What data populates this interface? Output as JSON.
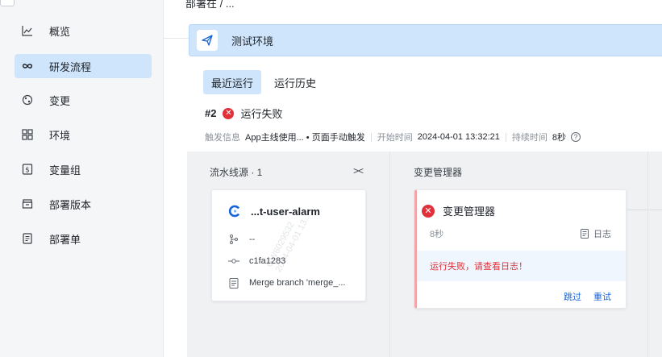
{
  "breadcrumb": "部署在 / ...",
  "sidebar": {
    "items": [
      {
        "label": "概览",
        "icon": "chart-line-icon"
      },
      {
        "label": "研发流程",
        "icon": "infinity-icon"
      },
      {
        "label": "变更",
        "icon": "change-icon"
      },
      {
        "label": "环境",
        "icon": "grid-icon"
      },
      {
        "label": "变量组",
        "icon": "variable-icon"
      },
      {
        "label": "部署版本",
        "icon": "box-icon"
      },
      {
        "label": "部署单",
        "icon": "document-icon"
      }
    ]
  },
  "environment": {
    "title": "测试环境",
    "icon": "plane-icon"
  },
  "tabs": [
    {
      "label": "最近运行",
      "active": true
    },
    {
      "label": "运行历史",
      "active": false
    }
  ],
  "run": {
    "number": "#2",
    "status": "运行失败",
    "trigger_label": "触发信息",
    "trigger_value": "App主线使用... • 页面手动触发",
    "start_label": "开始时间",
    "start_value": "2024-04-01 13:32:21",
    "duration_label": "持续时间",
    "duration_value": "8秒"
  },
  "stages": {
    "source_title": "流水线源 · 1",
    "change_title": "变更管理器",
    "source_card": {
      "name": "...t-user-alarm",
      "branch": "--",
      "commit": "c1fa1283",
      "message": "Merge branch 'merge_..."
    },
    "change_card": {
      "name": "变更管理器",
      "duration": "8秒",
      "log_label": "日志",
      "error": "运行失败，请查看日志！",
      "skip_label": "跳过",
      "retry_label": "重试"
    }
  },
  "watermark": [
    "GW6029532",
    "2024-04-01 13..."
  ],
  "colors": {
    "accent": "#1664d9",
    "active_bg": "#cfe5fb",
    "error": "#e0303a"
  }
}
